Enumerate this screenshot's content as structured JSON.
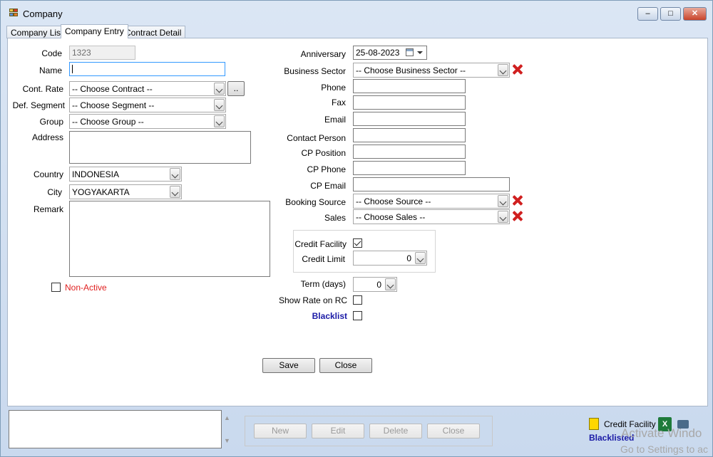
{
  "window": {
    "title": "Company",
    "minimize": "–",
    "maximize": "□",
    "close": "✕",
    "icon": "app-grid-icon"
  },
  "tabs": [
    "Company List",
    "Company Entry",
    "Contract Detail"
  ],
  "left": {
    "code_label": "Code",
    "code_value": "1323",
    "name_label": "Name",
    "name_value": "",
    "cont_rate_label": "Cont. Rate",
    "cont_rate_value": "-- Choose Contract --",
    "browse_label": "..",
    "segment_label": "Def. Segment",
    "segment_value": "-- Choose Segment --",
    "group_label": "Group",
    "group_value": "-- Choose Group --",
    "address_label": "Address",
    "country_label": "Country",
    "country_value": "INDONESIA",
    "city_label": "City",
    "city_value": "YOGYAKARTA",
    "remark_label": "Remark",
    "nonactive_label": "Non-Active"
  },
  "right": {
    "anniversary_label": "Anniversary",
    "anniversary_value": "25-08-2023",
    "business_sector_label": "Business Sector",
    "business_sector_value": "-- Choose Business Sector --",
    "phone_label": "Phone",
    "fax_label": "Fax",
    "email_label": "Email",
    "contact_person_label": "Contact Person",
    "cp_position_label": "CP Position",
    "cp_phone_label": "CP Phone",
    "cp_email_label": "CP Email",
    "booking_source_label": "Booking Source",
    "booking_source_value": "-- Choose Source --",
    "sales_label": "Sales",
    "sales_value": "-- Choose Sales --",
    "credit_facility_label": "Credit Facility",
    "credit_limit_label": "Credit Limit",
    "credit_limit_value": "0",
    "term_label": "Term (days)",
    "term_value": "0",
    "show_rate_label": "Show Rate on RC",
    "blacklist_label": "Blacklist"
  },
  "actions": {
    "save": "Save",
    "close": "Close"
  },
  "bottom": {
    "new": "New",
    "edit": "Edit",
    "delete": "Delete",
    "close": "Close",
    "legend_credit": "Credit Facility",
    "legend_blacklisted": "Blacklisted",
    "watermark_line1": "Activate Windo",
    "watermark_line2": "Go to Settings to ac"
  },
  "colors": {
    "blacklist": "#1a1aa6",
    "nonactive": "#e02020",
    "credit_swatch": "#ffd700"
  }
}
